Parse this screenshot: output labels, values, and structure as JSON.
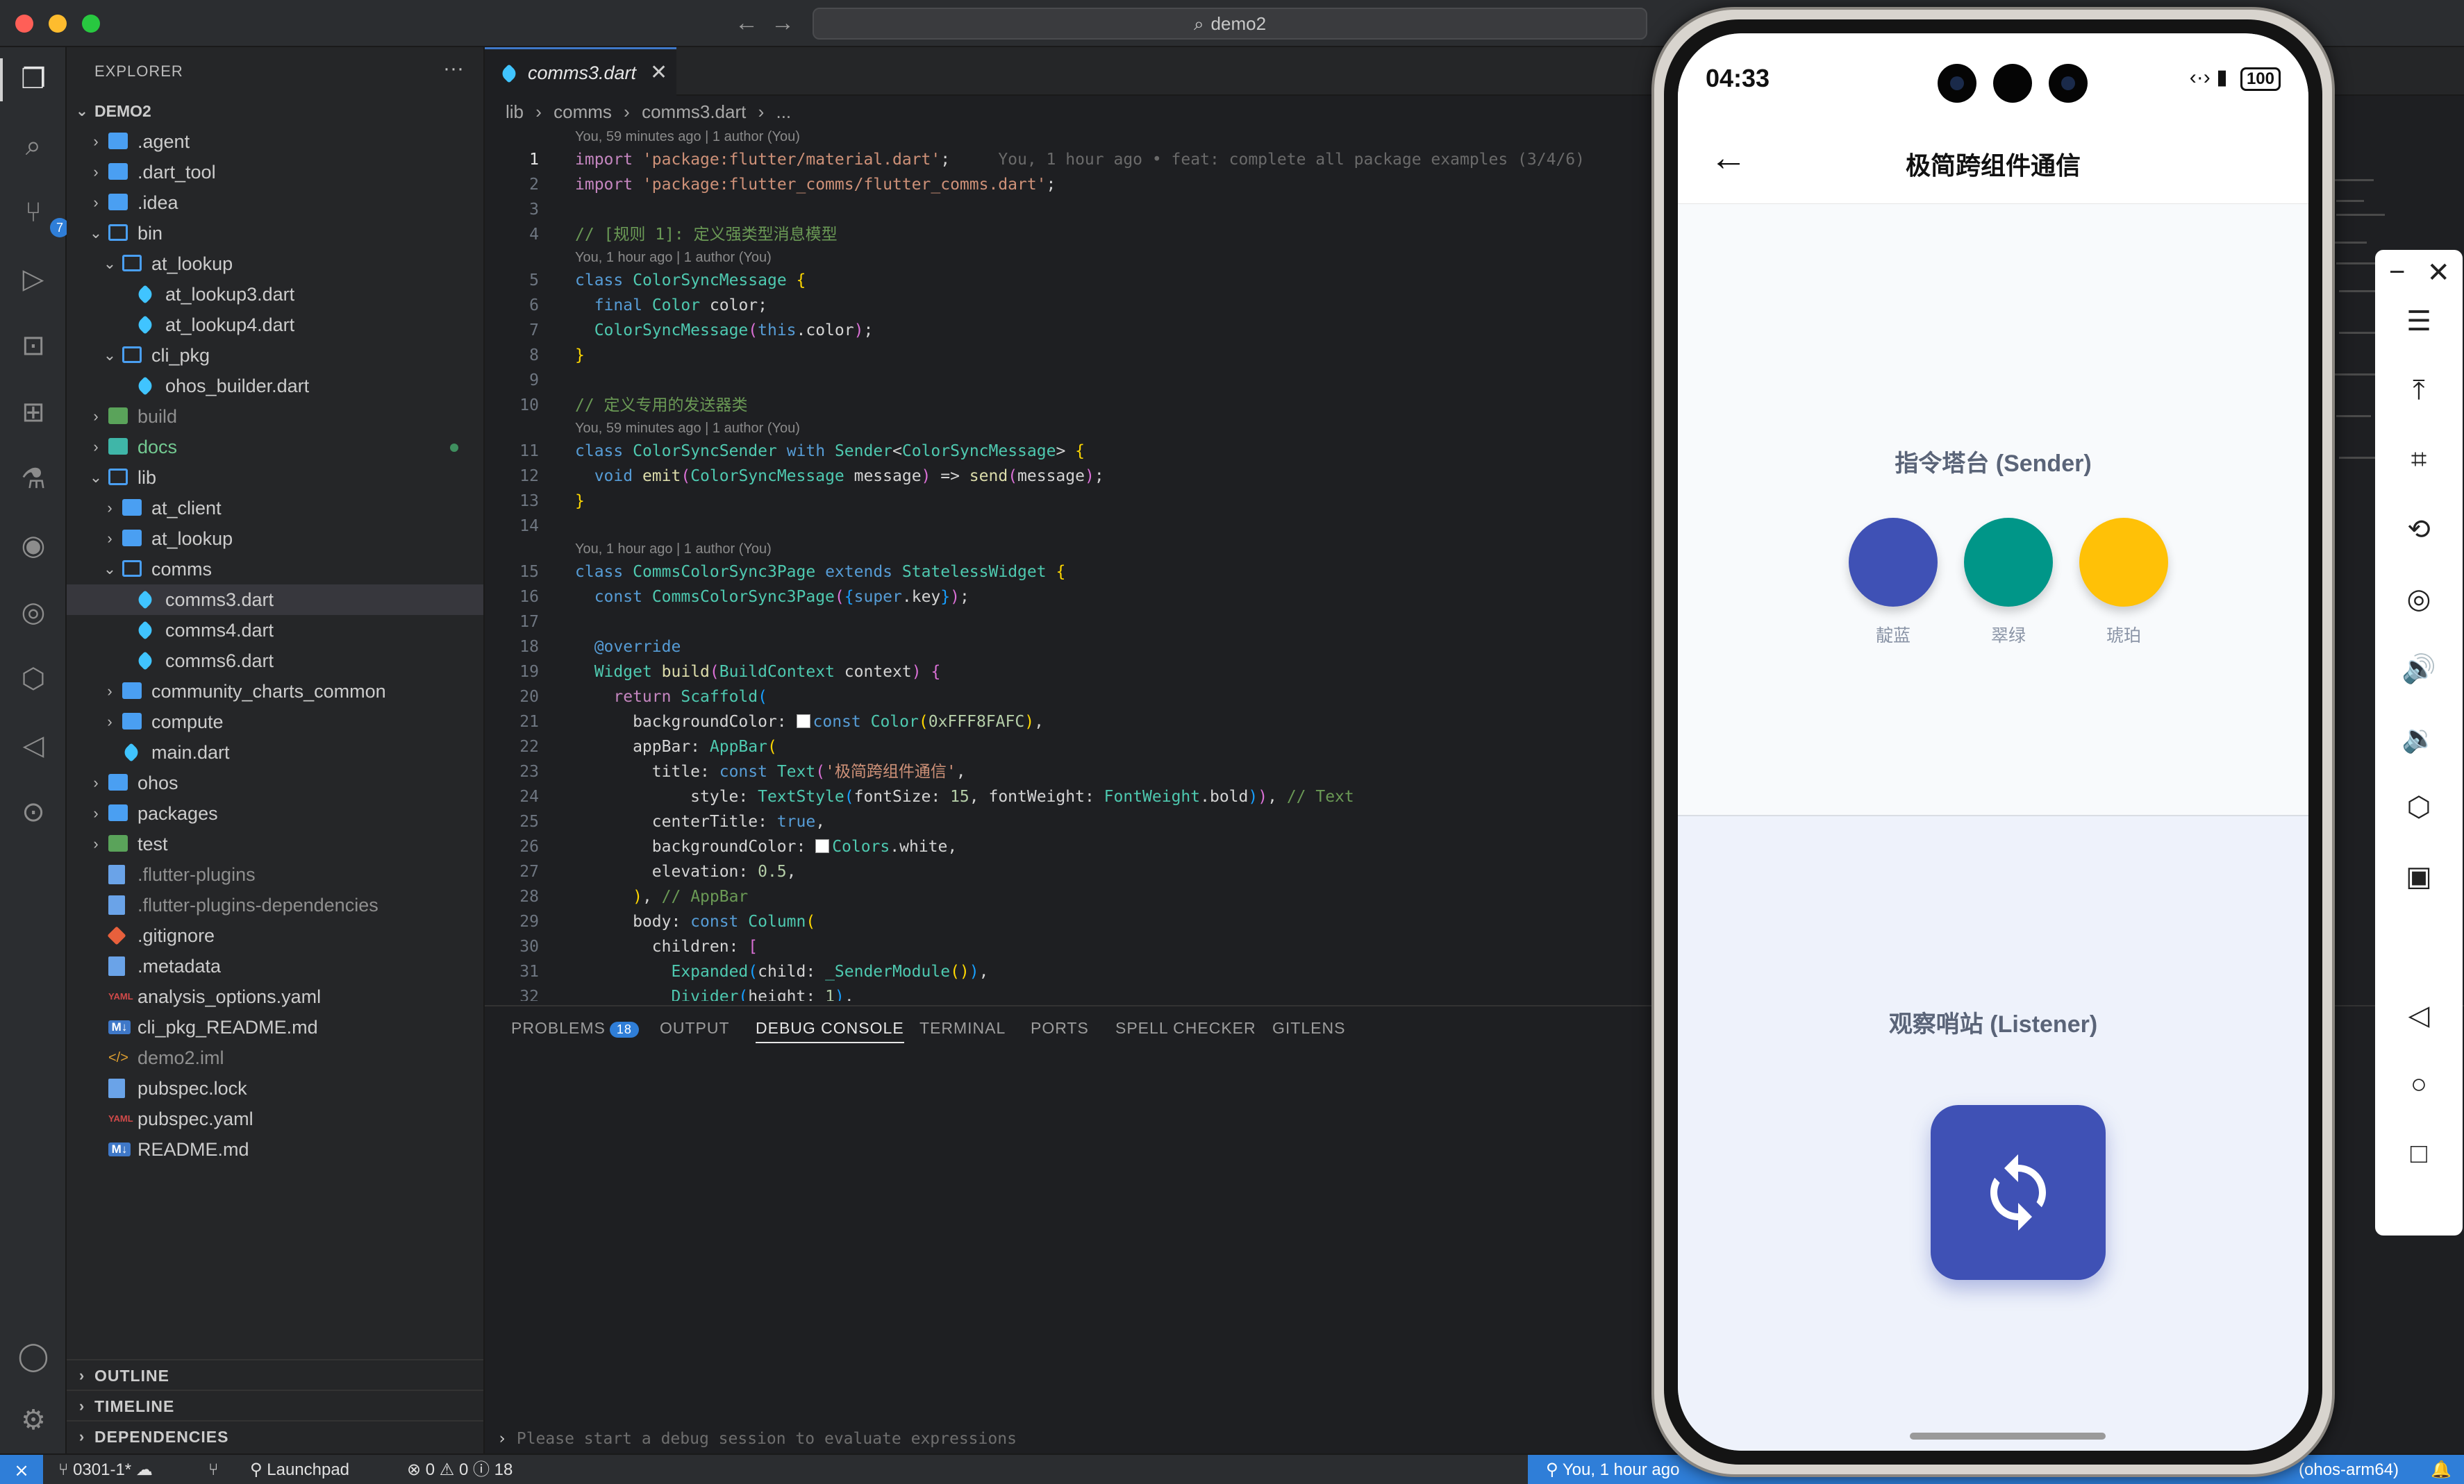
{
  "titlebar": {
    "search_text": "demo2",
    "back_arrow": "←",
    "forward_arrow": "→"
  },
  "activity_bar": {
    "items": [
      "explorer-icon",
      "search-icon",
      "source-control-icon",
      "run-debug-icon",
      "remote-explorer-icon",
      "extensions-icon",
      "testing-icon",
      "gitlens-icon",
      "github-icon",
      "containers-icon",
      "flutter-icon",
      "scan-icon"
    ],
    "source_control_badge": "7",
    "bottom": [
      "account-icon",
      "settings-icon"
    ]
  },
  "sidebar": {
    "title": "EXPLORER",
    "more": "···",
    "root": "DEMO2",
    "tree": [
      {
        "label": ".agent",
        "type": "folder",
        "depth": 1,
        "expanded": false
      },
      {
        "label": ".dart_tool",
        "type": "folder",
        "depth": 1,
        "expanded": false
      },
      {
        "label": ".idea",
        "type": "folder",
        "depth": 1,
        "expanded": false
      },
      {
        "label": "bin",
        "type": "folder",
        "depth": 1,
        "expanded": true
      },
      {
        "label": "at_lookup",
        "type": "folder",
        "depth": 2,
        "expanded": true
      },
      {
        "label": "at_lookup3.dart",
        "type": "dart",
        "depth": 3
      },
      {
        "label": "at_lookup4.dart",
        "type": "dart",
        "depth": 3
      },
      {
        "label": "cli_pkg",
        "type": "folder",
        "depth": 2,
        "expanded": true
      },
      {
        "label": "ohos_builder.dart",
        "type": "dart",
        "depth": 3
      },
      {
        "label": "build",
        "type": "folder-green",
        "depth": 1,
        "expanded": false,
        "dim": true
      },
      {
        "label": "docs",
        "type": "folder-teal",
        "depth": 1,
        "expanded": false,
        "green": true
      },
      {
        "label": "lib",
        "type": "folder",
        "depth": 1,
        "expanded": true
      },
      {
        "label": "at_client",
        "type": "folder",
        "depth": 2,
        "expanded": false
      },
      {
        "label": "at_lookup",
        "type": "folder",
        "depth": 2,
        "expanded": false
      },
      {
        "label": "comms",
        "type": "folder",
        "depth": 2,
        "expanded": true
      },
      {
        "label": "comms3.dart",
        "type": "dart",
        "depth": 3,
        "selected": true
      },
      {
        "label": "comms4.dart",
        "type": "dart",
        "depth": 3
      },
      {
        "label": "comms6.dart",
        "type": "dart",
        "depth": 3
      },
      {
        "label": "community_charts_common",
        "type": "folder",
        "depth": 2,
        "expanded": false
      },
      {
        "label": "compute",
        "type": "folder",
        "depth": 2,
        "expanded": false
      },
      {
        "label": "main.dart",
        "type": "dart",
        "depth": 2
      },
      {
        "label": "ohos",
        "type": "folder",
        "depth": 1,
        "expanded": false
      },
      {
        "label": "packages",
        "type": "folder",
        "depth": 1,
        "expanded": false
      },
      {
        "label": "test",
        "type": "folder-green",
        "depth": 1,
        "expanded": false
      },
      {
        "label": ".flutter-plugins",
        "type": "file",
        "depth": 1,
        "dim": true
      },
      {
        "label": ".flutter-plugins-dependencies",
        "type": "file",
        "depth": 1,
        "dim": true
      },
      {
        "label": ".gitignore",
        "type": "git",
        "depth": 1
      },
      {
        "label": ".metadata",
        "type": "file",
        "depth": 1
      },
      {
        "label": "analysis_options.yaml",
        "type": "yaml",
        "depth": 1
      },
      {
        "label": "cli_pkg_README.md",
        "type": "md",
        "depth": 1
      },
      {
        "label": "demo2.iml",
        "type": "code",
        "depth": 1,
        "dim": true
      },
      {
        "label": "pubspec.lock",
        "type": "file",
        "depth": 1
      },
      {
        "label": "pubspec.yaml",
        "type": "yaml",
        "depth": 1
      },
      {
        "label": "README.md",
        "type": "md",
        "depth": 1
      }
    ],
    "sections": [
      "OUTLINE",
      "TIMELINE",
      "DEPENDENCIES"
    ]
  },
  "editor": {
    "tab_label": "comms3.dart",
    "breadcrumb": [
      "lib",
      "›",
      "comms",
      "›",
      "comms3.dart",
      "›",
      "..."
    ],
    "lens": {
      "top": "You, 59 minutes ago | 1 author (You)",
      "l5": "You, 1 hour ago | 1 author (You)",
      "l11": "You, 59 minutes ago | 1 author (You)",
      "l15": "You, 1 hour ago | 1 author (You)"
    },
    "blame_line1": "You, 1 hour ago • feat: complete all package examples (3/4/6)"
  },
  "panel": {
    "tabs": [
      "PROBLEMS",
      "OUTPUT",
      "DEBUG CONSOLE",
      "TERMINAL",
      "PORTS",
      "SPELL CHECKER",
      "GITLENS"
    ],
    "problems_badge": "18",
    "active_tab": "DEBUG CONSOLE",
    "debug_placeholder": "Please start a debug session to evaluate expressions"
  },
  "statusbar": {
    "branch": "0301-1*",
    "launchpad": "Launchpad",
    "problems": "⊗ 0 ⚠ 0 ⓘ 18",
    "blame": "You, 1 hour ago",
    "device": "(ohos-arm64)"
  },
  "phone": {
    "time": "04:33",
    "network": "‹·›",
    "battery": "100",
    "appbar_title": "极简跨组件通信",
    "sender_title": "指令塔台 (Sender)",
    "swatches": [
      {
        "label": "靛蓝",
        "color": "#3f51b5"
      },
      {
        "label": "翠绿",
        "color": "#009688"
      },
      {
        "label": "琥珀",
        "color": "#ffc107"
      }
    ],
    "listener_title": "观察哨站 (Listener)",
    "listener_color": "#3f51b5"
  },
  "side_toolbar": {
    "window_controls": [
      "−",
      "✕"
    ],
    "tools": [
      "menu-icon",
      "pin-icon",
      "crop-icon",
      "rotate-icon",
      "screenshot-icon",
      "volume-up-icon",
      "volume-down-icon",
      "shake-icon",
      "multi-device-icon",
      "back-icon",
      "home-icon",
      "recents-icon"
    ]
  }
}
